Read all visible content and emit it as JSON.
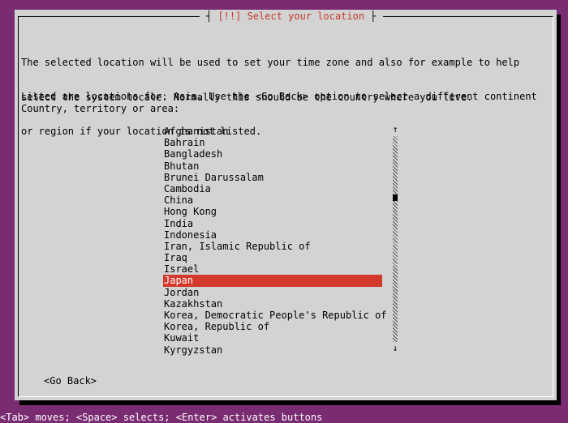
{
  "dialog": {
    "title": "[!!] Select your location",
    "description_line1": "The selected location will be used to set your time zone and also for example to help",
    "description_line2": "select the system locale. Normally this should be the country where you live.",
    "listed_line1": "Listed are locations for: Asia. Use the <Go Back> option to select a different continent",
    "listed_line2": "or region if your location is not listed.",
    "prompt": "Country, territory or area:",
    "countries": [
      "Afghanistan",
      "Bahrain",
      "Bangladesh",
      "Bhutan",
      "Brunei Darussalam",
      "Cambodia",
      "China",
      "Hong Kong",
      "India",
      "Indonesia",
      "Iran, Islamic Republic of",
      "Iraq",
      "Israel",
      "Japan",
      "Jordan",
      "Kazakhstan",
      "Korea, Democratic People's Republic of",
      "Korea, Republic of",
      "Kuwait",
      "Kyrgyzstan"
    ],
    "selected_country": "Japan",
    "scroll_up_glyph": "↑",
    "scroll_down_glyph": "↓",
    "go_back_label": "<Go Back>"
  },
  "status_bar": {
    "text": "<Tab> moves; <Space> selects; <Enter> activates buttons"
  },
  "colors": {
    "background": "#7a2c72",
    "dialog": "#d3d3d3",
    "title_text": "#c53a2a",
    "selection": "#d3392c"
  }
}
